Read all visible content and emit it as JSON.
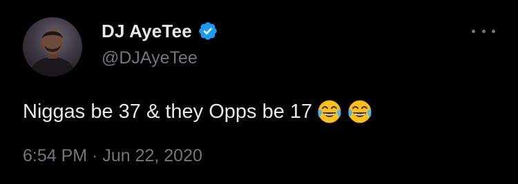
{
  "author": {
    "display_name": "DJ AyeTee",
    "handle": "@DJAyeTee",
    "verified": true,
    "verified_color": "#1d9bf0"
  },
  "tweet": {
    "text": "Niggas be 37 & they Opps be 17",
    "emojis": [
      "tears-of-joy-emoji",
      "tears-of-joy-emoji"
    ]
  },
  "meta": {
    "time": "6:54 PM",
    "separator": " · ",
    "date": "Jun 22, 2020"
  },
  "colors": {
    "background": "#000000",
    "primary_text": "#e7e9ea",
    "secondary_text": "#71767b"
  }
}
